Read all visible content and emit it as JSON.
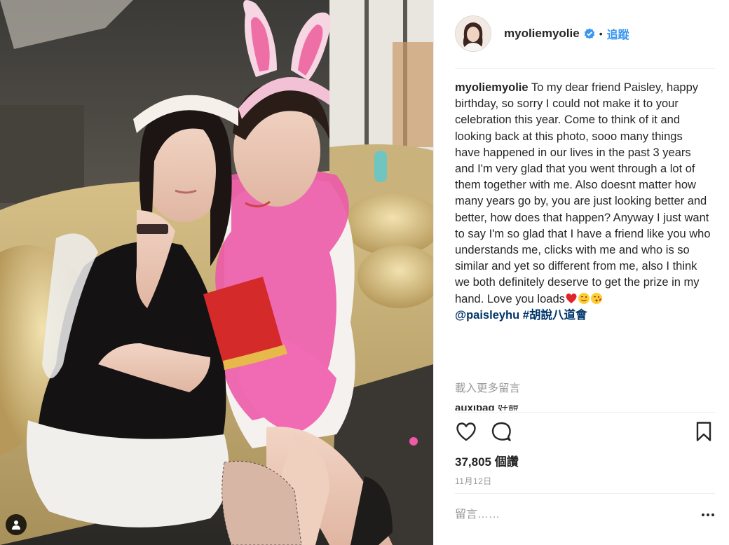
{
  "post": {
    "username": "myoliemyolie",
    "verified_icon": "verified-badge-icon",
    "separator": "•",
    "follow_label": "追蹤",
    "caption_username": "myoliemyolie",
    "caption_text": "To my dear friend Paisley, happy birthday, so sorry I could not make it to your celebration this year. Come to think of it and looking back at this photo, sooo many things have happened in our lives in the past 3 years and I'm very glad that you went through a lot of them together with me. Also doesnt matter how many years go by, you are just looking better and better, how does that happen? Anyway I just want to say I'm so glad that I have a friend like you who understands me, clicks with me and who is so similar and yet so different from me, also I think we both definitely deserve to get the prize in my hand. Love you loads",
    "caption_emojis": [
      "heart-emoji",
      "wink-emoji",
      "kiss-emoji"
    ],
    "mention": "@paisleyhu",
    "hashtag": "#胡說八道會",
    "load_more_label": "載入更多留言",
    "peek_comment_user": "auxibag",
    "peek_comment_text": "好靚",
    "likes": "37,805 個讚",
    "date": "11月12日",
    "comment_placeholder": "留言……",
    "accent_color": "#3897f0",
    "link_color": "#003569"
  },
  "icons": {
    "like": "heart-outline-icon",
    "comment": "speech-bubble-icon",
    "save": "bookmark-icon",
    "more": "ellipsis-icon",
    "tag": "user-tag-icon"
  }
}
